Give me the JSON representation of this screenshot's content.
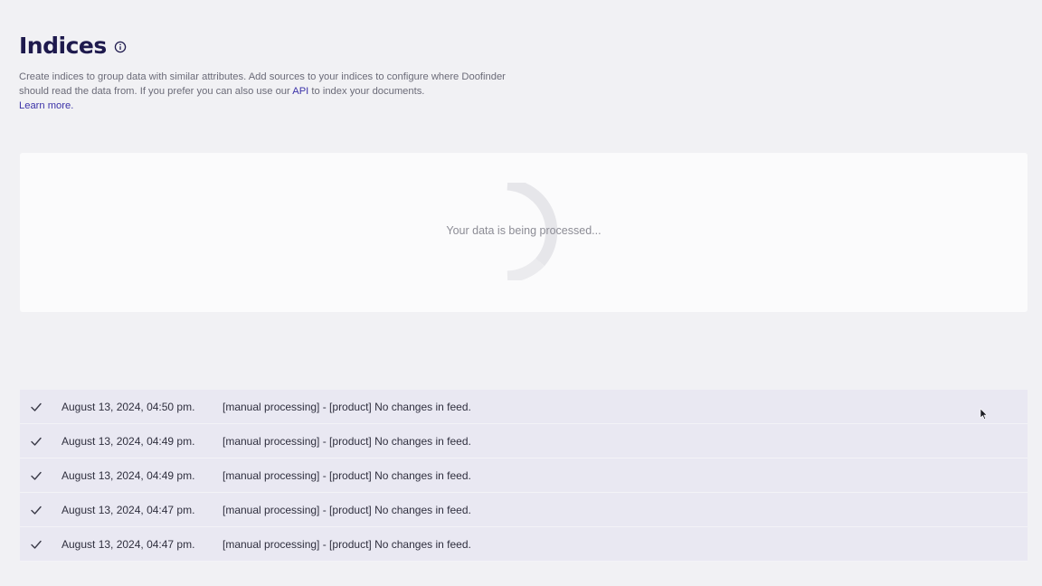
{
  "header": {
    "title": "Indices",
    "description_part1": "Create indices to group data with similar attributes. Add sources to your indices to configure where Doofinder should read the data from. If you prefer you can also use our ",
    "api_link": "API",
    "description_part2": " to index your documents.",
    "learn_more": "Learn more."
  },
  "panel": {
    "processing_text": "Your data is being processed..."
  },
  "log": {
    "rows": [
      {
        "date": "August 13, 2024, 04:50 pm.",
        "message": "[manual processing] - [product] No changes in feed."
      },
      {
        "date": "August 13, 2024, 04:49 pm.",
        "message": "[manual processing] - [product] No changes in feed."
      },
      {
        "date": "August 13, 2024, 04:49 pm.",
        "message": "[manual processing] - [product] No changes in feed."
      },
      {
        "date": "August 13, 2024, 04:47 pm.",
        "message": "[manual processing] - [product] No changes in feed."
      },
      {
        "date": "August 13, 2024, 04:47 pm.",
        "message": "[manual processing] - [product] No changes in feed."
      }
    ]
  }
}
